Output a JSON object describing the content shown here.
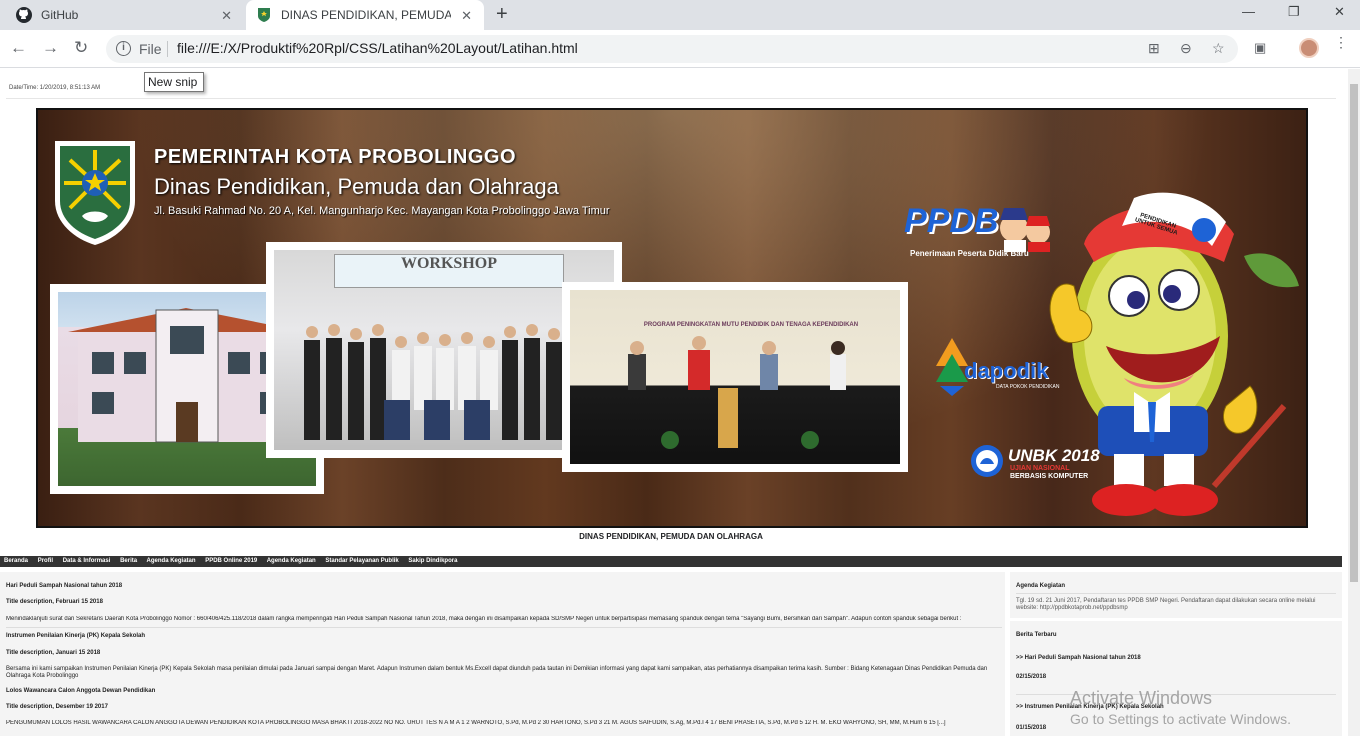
{
  "browser": {
    "tabs": [
      {
        "title": "GitHub",
        "active": false
      },
      {
        "title": "DINAS PENDIDIKAN, PEMUDA DAN OLAHRAGA",
        "active": true
      }
    ],
    "new_tab_icon": "+",
    "address": {
      "scheme": "File",
      "url": "file:///E:/X/Produktif%20Rpl/CSS/Latihan%20Layout/Latihan.html"
    },
    "tooltip": "New snip"
  },
  "page": {
    "datetime": "Date/Time: 1/20/2019, 8:51:13 AM",
    "banner": {
      "line1": "PEMERINTAH KOTA PROBOLINGGO",
      "line2": "Dinas Pendidikan, Pemuda dan Olahraga",
      "line3": "Jl. Basuki Rahmad No. 20 A, Kel. Mangunharjo Kec. Mayangan Kota Probolinggo Jawa Timur",
      "ppdb": "PPDB",
      "ppdb_sub": "Penerimaan Peserta Didik Baru",
      "dapodik": "dapodik",
      "dapodik_sub": "DATA POKOK PENDIDIKAN",
      "unbk": "UNBK 2018",
      "unbk_sub1": "UJIAN NASIONAL",
      "unbk_sub2": "BERBASIS KOMPUTER",
      "workshop": "WORKSHOP",
      "cap_hat": "PENDIDIKAN UNTUK SEMUA",
      "program": "PROGRAM PENINGKATAN MUTU PENDIDIK DAN TENAGA KEPENDIDIKAN"
    },
    "caption": "DINAS PENDIDIKAN, PEMUDA DAN OLAHRAGA",
    "nav": [
      "Beranda",
      "Profil",
      "Data & Informasi",
      "Berita",
      "Agenda Kegiatan",
      "PPDB Online 2019",
      "Agenda Kegiatan",
      "Standar Pelayanan Publik",
      "Sakip Dindikpora"
    ],
    "articles": [
      {
        "title": "Hari Peduli Sampah Nasional tahun 2018",
        "desc": "Title description, Februari 15 2018",
        "body": "Menindaklanjuti surat dari Sekretaris Daerah Kota Probolinggo Nomor : 660/406/425.118/2018 dalam rangka memperingati Hari Peduli Sampah Nasional Tahun 2018, maka dengan ini disampaikan kepada SD/SMP Negeri untuk berpartisipasi memasang spanduk dengan tema \"Sayangi Bumi, Bersihkan dari Sampah\". Adapun contoh spanduk sebagai berikut :"
      },
      {
        "title": "Instrumen Penilaian Kinerja (PK) Kepala Sekolah",
        "desc": "Title description, Januari 15 2018",
        "body": "Bersama ini kami sampaikan Instrumen Penilaian Kinerja (PK) Kepala Sekolah masa penilaian dimulai pada Januari sampai dengan Maret. Adapun Instrumen dalam bentuk Ms.Excell dapat diunduh pada tautan ini Demikian informasi yang dapat kami sampaikan, atas perhatiannya disampaikan terima kasih. Sumber : Bidang Ketenagaan Dinas Pendidikan Pemuda dan Olahraga Kota Probolinggo"
      },
      {
        "title": "Lolos Wawancara Calon Anggota Dewan Pendidikan",
        "desc": "Title description, Desember 19 2017",
        "body": "PENGUMUMAN LOLOS HASIL WAWANCARA CALON ANGGOTA DEWAN PENDIDIKAN KOTA PROBOLINGGO MASA BHAKTI 2018-2022 NO NO. URUT TES N A M A 1 2 WARNOTO, S.Pd, M.Pd 2 30 HARTONO, S.Pd 3 21 M. AGUS SAIFUDIN, S.Ag, M.Pd.I 4 17 BENI PRASETIA, S.Pd, M.Pd 5 12 H. M. EKO WAHYONO, SH, MM, M.Hum 6 15 [...]"
      }
    ],
    "sidebar": {
      "agenda_title": "Agenda Kegiatan",
      "agenda_text": "Tgl. 19 sd. 21 Juni 2017, Pendaftaran tes PPDB SMP Negeri. Pendaftaran dapat dilakukan secara online melalui website: http://ppdbkotaprob.net/ppdbsmp",
      "berita_title": "Berita Terbaru",
      "berita": [
        {
          "title": ">> Hari Peduli Sampah Nasional tahun 2018",
          "date": "02/15/2018"
        },
        {
          "title": ">> Instrumen Penilaian Kinerja (PK) Kepala Sekolah",
          "date": "01/15/2018"
        }
      ]
    }
  },
  "watermark": {
    "line1": "Activate Windows",
    "line2": "Go to Settings to activate Windows."
  }
}
